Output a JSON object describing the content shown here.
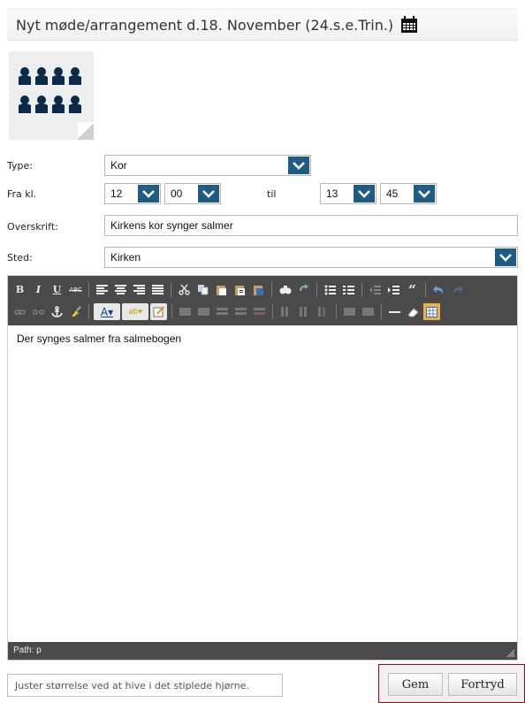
{
  "header": {
    "title": "Nyt møde/arrangement d.18. November (24.s.e.Trin.)",
    "icon": "calendar-icon"
  },
  "thumbnail": {
    "icon": "choir-group-icon",
    "color": "#0b2a4a"
  },
  "form": {
    "type_label": "Type:",
    "type_value": "Kor",
    "from_label": "Fra kl.",
    "from_hour": "12",
    "from_minute": "00",
    "to_label": "til",
    "to_hour": "13",
    "to_minute": "45",
    "heading_label": "Overskrift:",
    "heading_value": "Kirkens kor synger salmer",
    "place_label": "Sted:",
    "place_value": "Kirken"
  },
  "editor": {
    "toolbar_row1": [
      "B",
      "I",
      "U",
      "ABC"
    ],
    "content": "Der synges salmer fra salmebogen",
    "path": "Path: p"
  },
  "footer": {
    "hint": "Juster størrelse ved at hive i det stiplede hjørne.",
    "save_label": "Gem",
    "cancel_label": "Fortryd"
  },
  "colors": {
    "accent": "#1e5b85",
    "toolbar": "#4a4a4a",
    "frame": "#b40000"
  }
}
